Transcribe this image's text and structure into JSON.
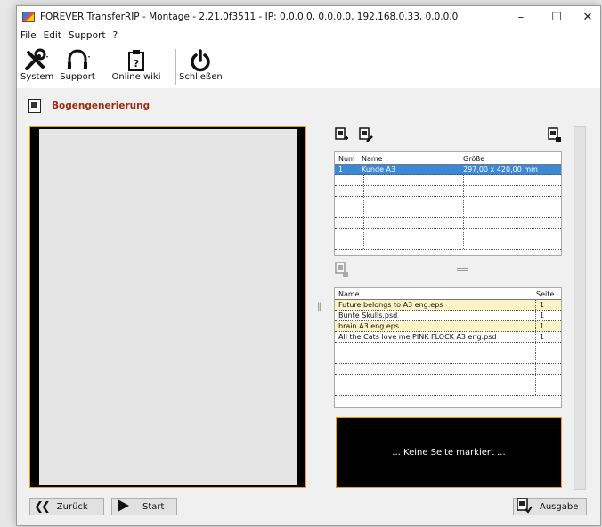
{
  "window": {
    "title": "FOREVER TransferRIP - Montage - 2.21.0f3511 - IP: 0.0.0.0, 0.0.0.0, 192.168.0.33, 0.0.0.0",
    "controls": {
      "minimize": "–",
      "maximize": "☐",
      "close": "✕"
    }
  },
  "menu": [
    "File",
    "Edit",
    "Support",
    "?"
  ],
  "toolbar": {
    "system": "System",
    "support": "Support",
    "wiki": "Online wiki",
    "close": "Schließen"
  },
  "section": {
    "title": "Bogengenerierung"
  },
  "sheets": {
    "headers": [
      "Num",
      "Name",
      "Größe"
    ],
    "rows": [
      {
        "num": "1",
        "name": "Kunde A3",
        "size": "297,00 x 420,00 mm"
      }
    ]
  },
  "files": {
    "headers": [
      "Name",
      "Seite"
    ],
    "rows": [
      {
        "name": "Future belongs to A3 eng.eps",
        "page": "1"
      },
      {
        "name": "Bunte Skulls.psd",
        "page": "1"
      },
      {
        "name": "brain A3 eng.eps",
        "page": "1"
      },
      {
        "name": "All the Cats love me PINK FLOCK A3 eng.psd",
        "page": "1"
      }
    ]
  },
  "info": {
    "text": "... Keine Seite markiert ..."
  },
  "buttons": {
    "back": "Zurück",
    "start": "Start",
    "output": "Ausgabe"
  }
}
